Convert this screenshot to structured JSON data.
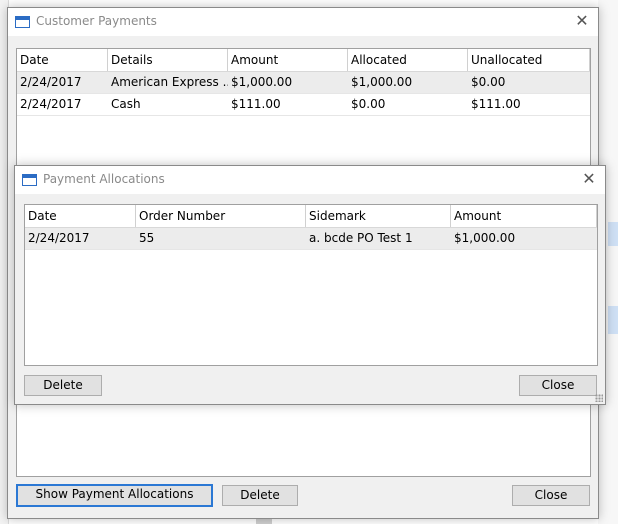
{
  "customer_payments": {
    "title": "Customer Payments",
    "columns": [
      "Date",
      "Details",
      "Amount",
      "Allocated",
      "Unallocated"
    ],
    "rows": [
      {
        "date": "2/24/2017",
        "details": "American Express ...",
        "amount": "$1,000.00",
        "allocated": "$1,000.00",
        "unallocated": "$0.00"
      },
      {
        "date": "2/24/2017",
        "details": "Cash",
        "amount": "$111.00",
        "allocated": "$0.00",
        "unallocated": "$111.00"
      }
    ],
    "buttons": {
      "show_allocations": "Show Payment Allocations",
      "delete": "Delete",
      "close": "Close"
    }
  },
  "payment_allocations": {
    "title": "Payment Allocations",
    "columns": [
      "Date",
      "Order Number",
      "Sidemark",
      "Amount"
    ],
    "rows": [
      {
        "date": "2/24/2017",
        "order_number": "55",
        "sidemark": "a. bcde PO Test 1",
        "amount": "$1,000.00"
      }
    ],
    "buttons": {
      "delete": "Delete",
      "close": "Close"
    }
  },
  "colors": {
    "window_bg": "#f0f0f0",
    "title_text": "#8a8a8a",
    "focus_border": "#2b78d4",
    "selected_row": "#ececec"
  },
  "icons": [
    "window-icon",
    "close-icon",
    "resize-grip-icon"
  ]
}
